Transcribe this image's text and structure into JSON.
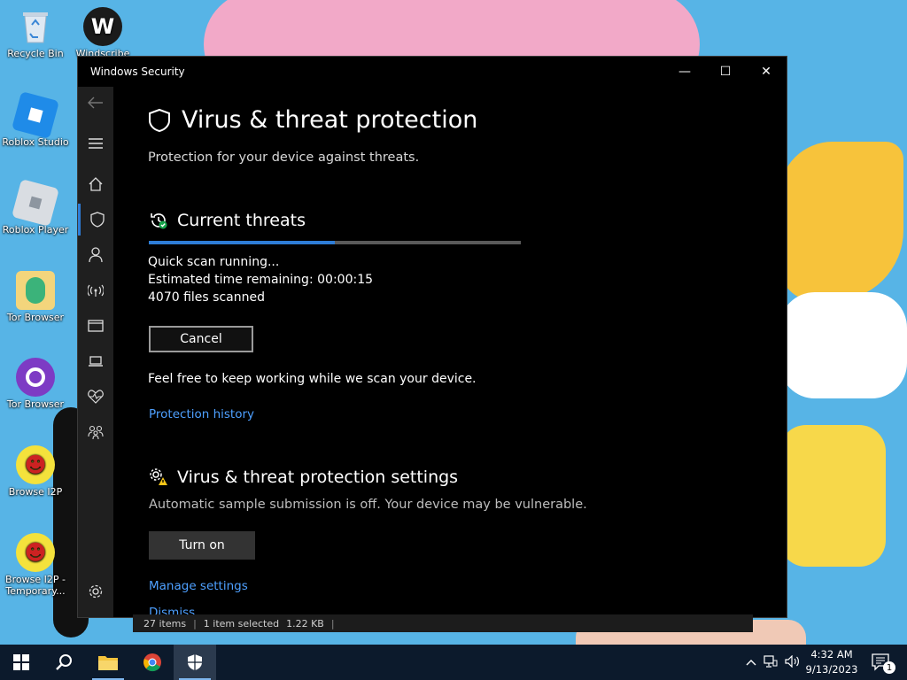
{
  "desktop": {
    "icons": [
      {
        "label": "Recycle Bin",
        "icon": "recycle-bin-icon"
      },
      {
        "label": "Windscribe",
        "icon": "windscribe-icon"
      },
      {
        "label": "Roblox Studio",
        "icon": "roblox-studio-icon"
      },
      {
        "label": "Roblox Player",
        "icon": "roblox-player-icon"
      },
      {
        "label": "Tor Browser",
        "icon": "tor-folder-icon"
      },
      {
        "label": "Tor Browser",
        "icon": "tor-browser-icon"
      },
      {
        "label": "Browse I2P",
        "icon": "i2p-icon"
      },
      {
        "label": "Browse I2P - Temporary...",
        "icon": "i2p-temp-icon"
      }
    ]
  },
  "window": {
    "title": "Windows Security",
    "controls": {
      "minimize": "—",
      "maximize": "☐",
      "close": "✕"
    }
  },
  "sidebar": {
    "items": [
      {
        "name": "back",
        "icon": "back-arrow-icon"
      },
      {
        "name": "menu",
        "icon": "hamburger-icon"
      },
      {
        "name": "home",
        "icon": "home-icon"
      },
      {
        "name": "virus-threat-protection",
        "icon": "shield-icon",
        "active": true
      },
      {
        "name": "account-protection",
        "icon": "person-icon"
      },
      {
        "name": "firewall-network",
        "icon": "wifi-antenna-icon"
      },
      {
        "name": "app-browser-control",
        "icon": "browser-window-icon"
      },
      {
        "name": "device-security",
        "icon": "laptop-icon"
      },
      {
        "name": "device-performance",
        "icon": "heart-pulse-icon"
      },
      {
        "name": "family-options",
        "icon": "family-icon"
      },
      {
        "name": "settings",
        "icon": "gear-icon"
      }
    ]
  },
  "main": {
    "title": "Virus & threat protection",
    "subtitle": "Protection for your device against threats.",
    "threats": {
      "heading": "Current threats",
      "progress": 0.5,
      "status": "Quick scan running...",
      "time_label": "Estimated time remaining:",
      "time_value": "00:00:15",
      "files_scanned": "4070 files scanned",
      "cancel_label": "Cancel",
      "note": "Feel free to keep working while we scan your device.",
      "history_link": "Protection history"
    },
    "settings": {
      "heading": "Virus & threat protection settings",
      "warning": "Automatic sample submission is off. Your device may be vulnerable.",
      "turn_on_label": "Turn on",
      "manage_link": "Manage settings",
      "dismiss_link": "Dismiss"
    }
  },
  "explorer_status": {
    "items": "27 items",
    "selected": "1 item selected",
    "size": "1.22 KB"
  },
  "taskbar": {
    "clock_time": "4:32 AM",
    "clock_date": "9/13/2023",
    "notification_count": "1",
    "accent": "#2e7dd7"
  }
}
